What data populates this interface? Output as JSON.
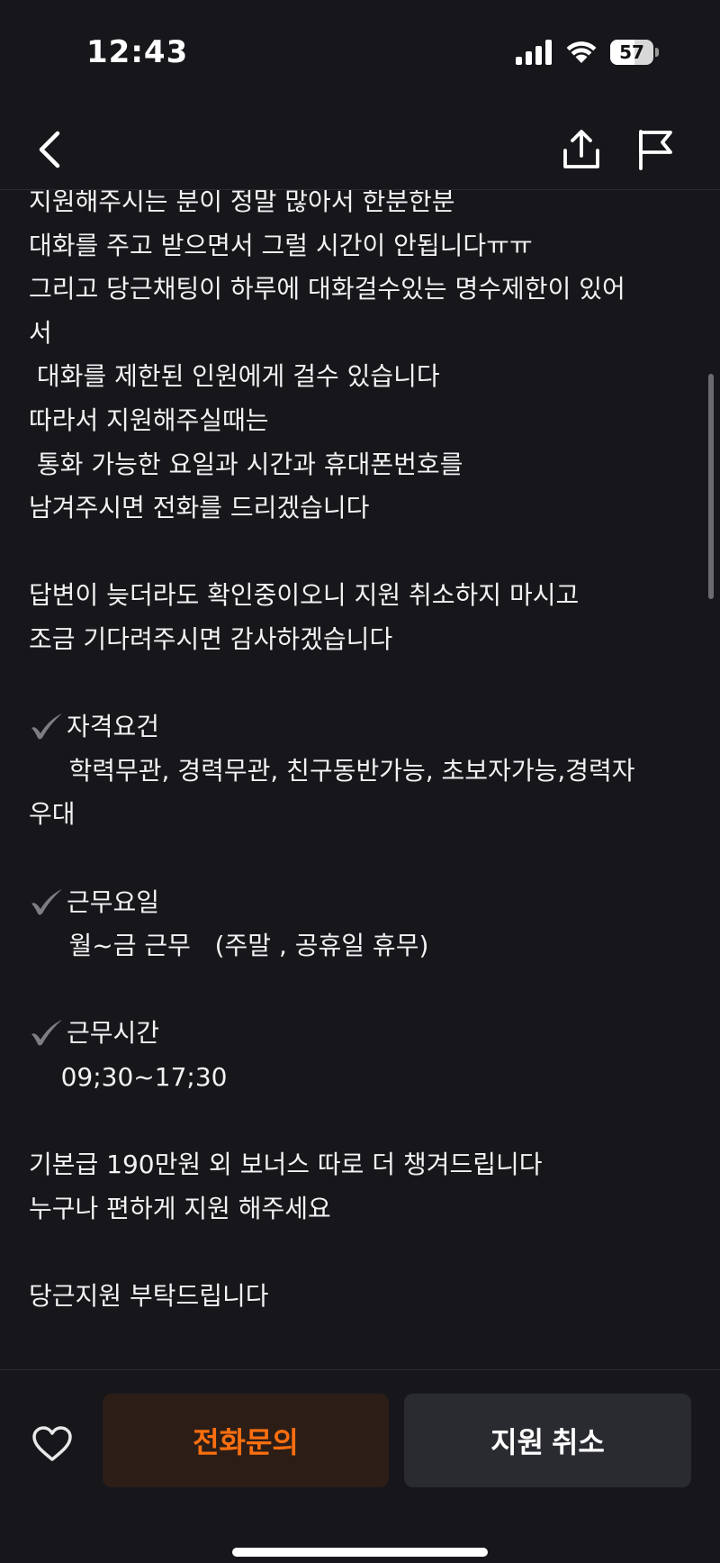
{
  "status_bar": {
    "time": "12:43",
    "battery_level": "57",
    "battery_percent": 57
  },
  "nav": {
    "icons": {
      "back": "chevron-left-icon",
      "share": "share-icon",
      "report": "flag-icon"
    }
  },
  "body_lines": [
    "지원해주시는 분이 정말 많아서 한분한분",
    "대화를 주고 받으면서 그럴 시간이 안됩니다ㅠㅠ",
    "그리고 당근채팅이 하루에 대화걸수있는 명수제한이 있어",
    "서",
    " 대화를 제한된 인원에게 걸수 있습니다",
    "따라서 지원해주실때는",
    " 통화 가능한 요일과 시간과 휴대폰번호를",
    "남겨주시면 전화를 드리겠습니다",
    "",
    "답변이 늦더라도 확인중이오니 지원 취소하지 마시고",
    "조금 기다려주시면 감사하겠습니다",
    "",
    "자격요건",
    "     학력무관, 경력무관, 친구동반가능, 초보자가능,경력자",
    "우대",
    "",
    "근무요일",
    "     월~금 근무   (주말 , 공휴일 휴무)",
    "",
    "근무시간",
    "    09;30~17;30",
    "",
    "기본급 190만원 외 보너스 따로 더 챙겨드립니다",
    "누구나 편하게 지원 해주세요",
    "",
    "당근지원 부탁드립니다"
  ],
  "checkmark_line_indexes": [
    12,
    16,
    19
  ],
  "bottom_bar": {
    "call_label": "전화문의",
    "cancel_label": "지원 취소",
    "accent_color": "#ff6f0f"
  }
}
